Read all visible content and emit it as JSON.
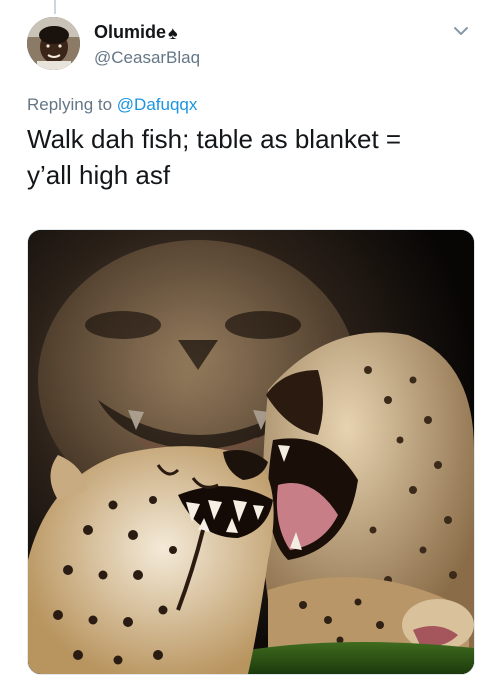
{
  "tweet": {
    "display_name": "Olumide",
    "name_emoji": "♠",
    "handle": "@CeasarBlaq",
    "replying_prefix": "Replying to",
    "replying_to": "@Dafuqqx",
    "text_line1": "Walk dah fish; table as blanket =",
    "text_line2": "y’all high asf"
  },
  "icons": {
    "more": "chevron-down-icon",
    "avatar": "profile-photo",
    "media": "laughing-cheetahs-photo"
  },
  "colors": {
    "text": "#14171a",
    "secondary": "#657786",
    "link": "#1b95e0",
    "border": "#e1e8ed"
  }
}
